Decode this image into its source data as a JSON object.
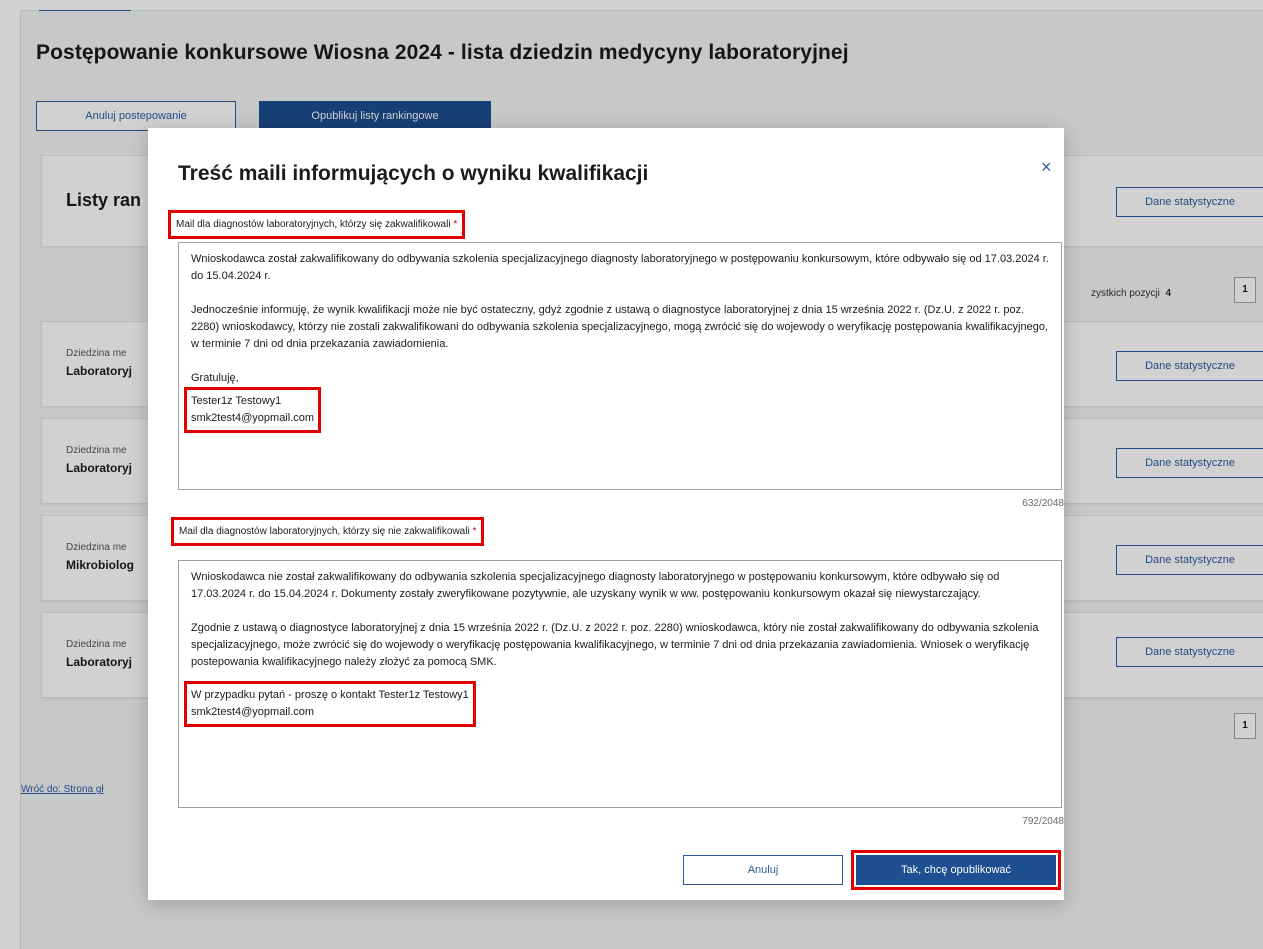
{
  "page": {
    "title": "Postępowanie konkursowe Wiosna 2024 - lista dziedzin medycyny laboratoryjnej",
    "cancel_procedure": "Anuluj postepowanie",
    "publish_rankings": "Opublikuj listy rankingowe",
    "listy_title": "Listy ran",
    "paging_text": "zystkich pozycji",
    "paging_count": "4",
    "page_number": "1",
    "back_link": "Wróć do: Strona gł",
    "stats_label": "Dane statystyczne",
    "rows": [
      {
        "label": "Dziedzina me",
        "value": "Laboratoryj"
      },
      {
        "label": "Dziedzina me",
        "value": "Laboratoryj"
      },
      {
        "label": "Dziedzina me",
        "value": "Mikrobiolog"
      },
      {
        "label": "Dziedzina me",
        "value": "Laboratoryj"
      }
    ]
  },
  "modal": {
    "title": "Treść maili informujących o wyniku kwalifikacji",
    "close": "×",
    "qualified": {
      "label": "Mail dla diagnostów laboratoryjnych, którzy się zakwalifikowali",
      "required": "*",
      "p1": "Wnioskodawca został zakwalifikowany do odbywania szkolenia specjalizacyjnego diagnosty laboratoryjnego w postępowaniu konkursowym, które odbywało się od 17.03.2024 r. do 15.04.2024 r.",
      "p2": "Jednocześnie informuję, że wynik kwalifikacji może nie być ostateczny, gdyż zgodnie z ustawą o diagnostyce laboratoryjnej z dnia 15 września 2022 r. (Dz.U. z 2022 r. poz. 2280) wnioskodawcy, którzy nie zostali zakwalifikowani do odbywania szkolenia specjalizacyjnego, mogą zwrócić się do wojewody o weryfikację postępowania kwalifikacyjnego, w terminie 7 dni od dnia przekazania zawiadomienia.",
      "p3": "Gratuluję,",
      "sig_name": "Tester1z Testowy1",
      "sig_email": "smk2test4@yopmail.com",
      "counter": "632/2048"
    },
    "not_qualified": {
      "label": "Mail dla diagnostów laboratoryjnych, którzy się nie zakwalifikowali",
      "required": "*",
      "p1": "Wnioskodawca nie został zakwalifikowany do odbywania szkolenia specjalizacyjnego  diagnosty laboratoryjnego w postępowaniu konkursowym, które odbywało się od 17.03.2024 r. do 15.04.2024  r.  Dokumenty zostały zweryfikowane pozytywnie, ale uzyskany wynik w ww. postępowaniu konkursowym okazał się niewystarczający.",
      "p2": "Zgodnie z ustawą o diagnostyce laboratoryjnej z dnia 15 września 2022 r. (Dz.U. z 2022 r. poz. 2280) wnioskodawca, który nie został zakwalifikowany do odbywania szkolenia specjalizacyjnego, może zwrócić się do wojewody o weryfikację postępowania kwalifikacyjnego, w terminie 7 dni od dnia przekazania zawiadomienia. Wniosek o weryfikację postepowania kwalifikacyjnego należy złożyć za pomocą SMK.",
      "contact": "W przypadku pytań - proszę o kontakt Tester1z Testowy1",
      "sig_email": "smk2test4@yopmail.com",
      "counter": "792/2048"
    },
    "cancel": "Anuluj",
    "confirm": "Tak, chcę opublikować"
  }
}
